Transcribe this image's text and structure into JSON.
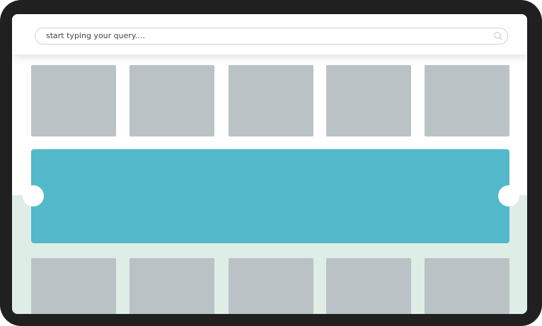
{
  "search": {
    "placeholder": "start typing your query....",
    "value": "",
    "icon": "search-icon"
  },
  "colors": {
    "frame": "#202020",
    "accent_band": "#53b8c9",
    "tile": "#bac2c5",
    "lower_background": "#deede6"
  },
  "top_tiles": [
    {},
    {},
    {},
    {},
    {}
  ],
  "bottom_tiles": [
    {},
    {},
    {},
    {},
    {}
  ]
}
